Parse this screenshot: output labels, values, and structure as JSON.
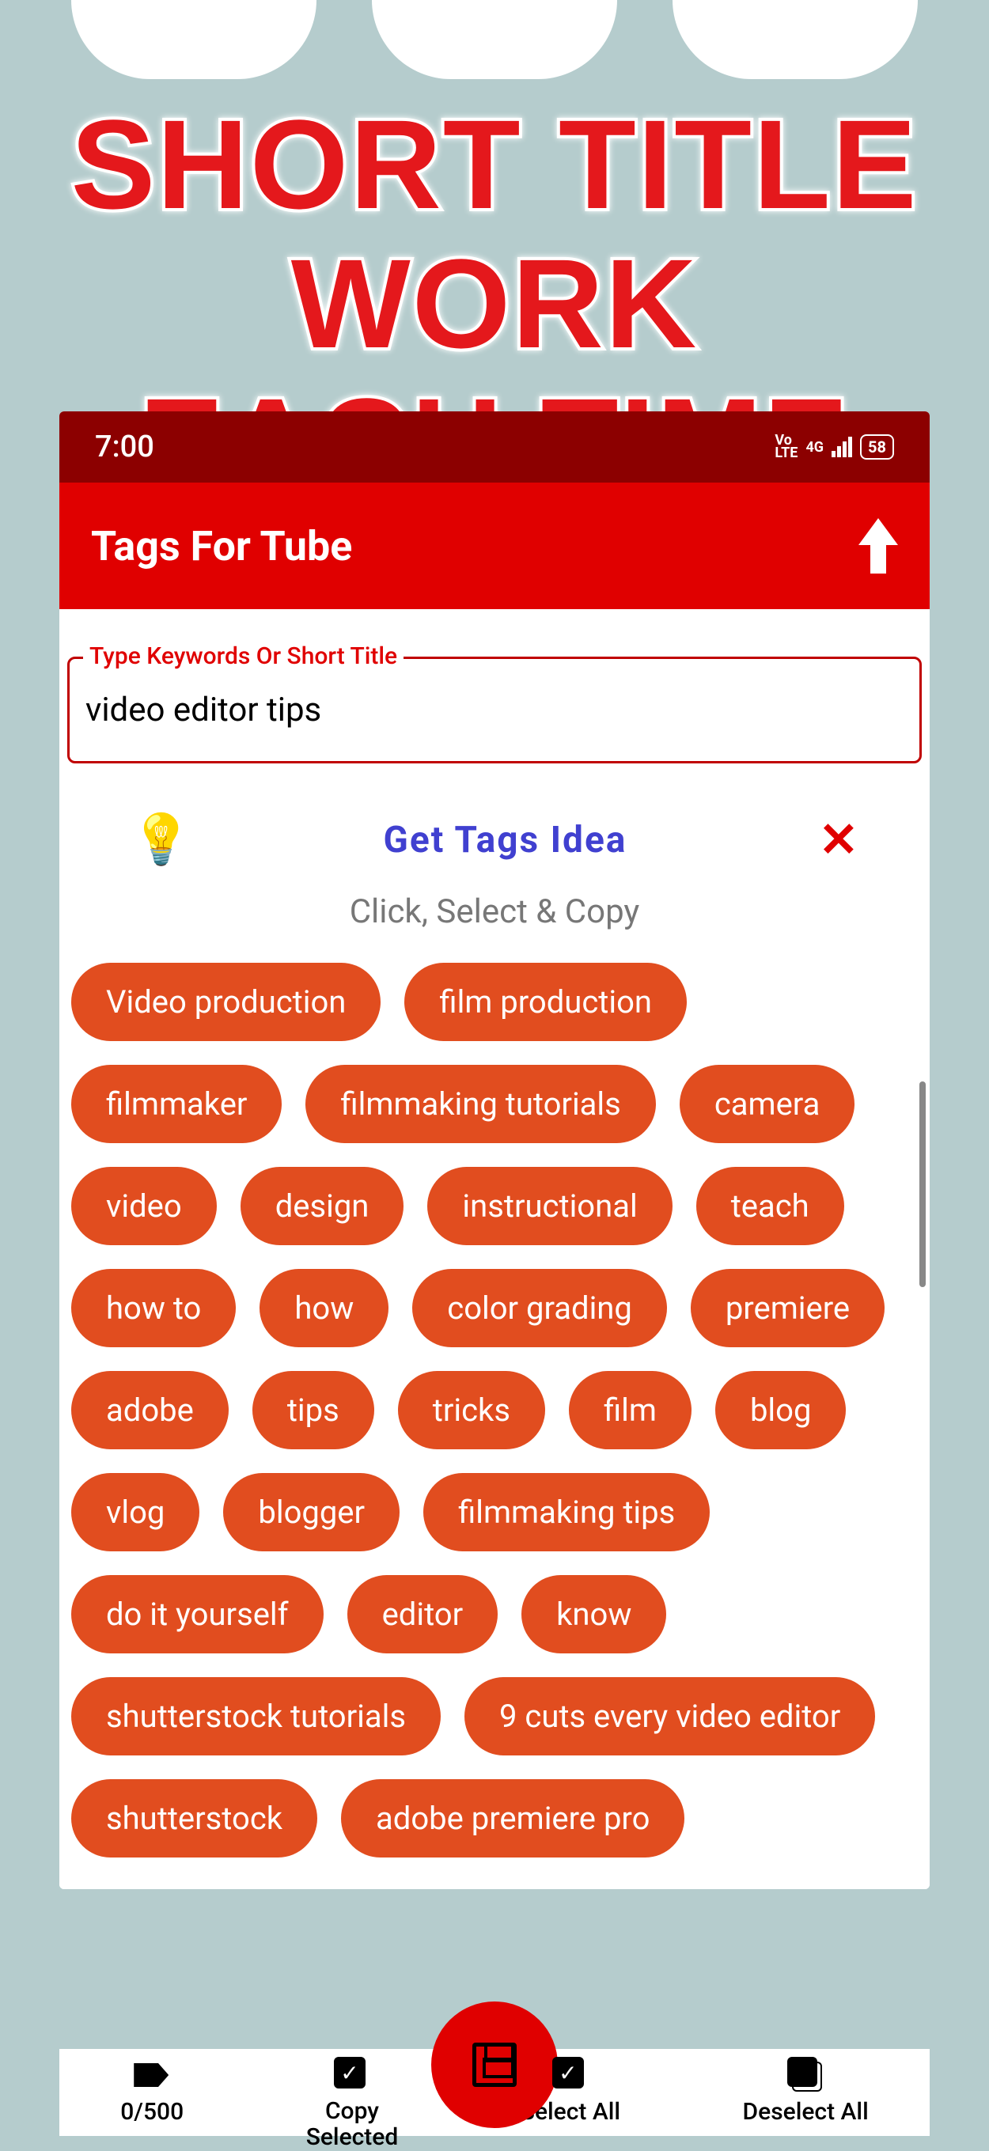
{
  "headline": {
    "line1": "SHORT TITLE WORK",
    "line2": "EACH TIME"
  },
  "status": {
    "time": "7:00",
    "volte": "Vo\nLTE",
    "net": "4G",
    "battery": "58"
  },
  "header": {
    "title": "Tags For Tube"
  },
  "input": {
    "label": "Type Keywords Or Short Title",
    "value": "video editor tips"
  },
  "actions": {
    "getTags": "Get Tags Idea"
  },
  "subtitle": "Click, Select & Copy",
  "tags": [
    "Video production",
    "film production",
    "filmmaker",
    "filmmaking tutorials",
    "camera",
    "video",
    "design",
    "instructional",
    "teach",
    "how to",
    "how",
    "color grading",
    "premiere",
    "adobe",
    "tips",
    "tricks",
    "film",
    "blog",
    "vlog",
    "blogger",
    "filmmaking tips",
    "do it yourself",
    "editor",
    "know",
    "shutterstock tutorials",
    "9 cuts every video editor",
    "shutterstock",
    "adobe premiere pro"
  ],
  "nav": {
    "counter": "0/500",
    "copy": "Copy\nSelected",
    "selectAll": "Select All",
    "deselectAll": "Deselect All"
  }
}
